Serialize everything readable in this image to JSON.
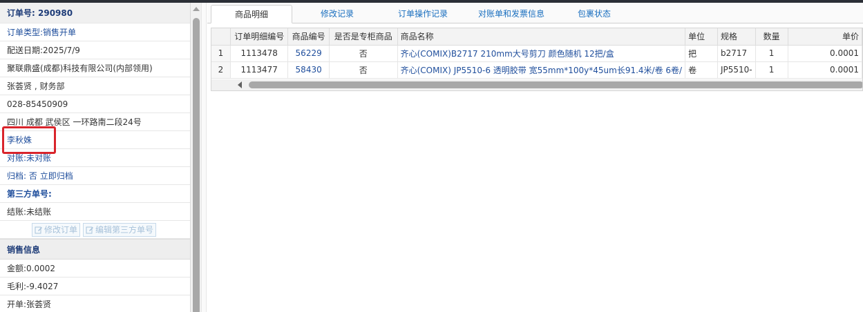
{
  "order": {
    "order_no_label": "订单号:",
    "order_no": "290980",
    "type_label": "订单类型:",
    "type_value": "销售开单",
    "delivery_date": "配送日期:2025/7/9",
    "company": "聚联鼎盛(成都)科技有限公司(内部领用)",
    "contact": "张荟贤 , 财务部",
    "phone": "028-85450909",
    "address": "四川 成都 武侯区 一环路南二段24号",
    "person": "李秋姝",
    "reconcile_label": "对账:",
    "reconcile_value": "未对账",
    "archive_label": "归档:",
    "archive_value": "否 立即归档",
    "third_party_label": "第三方单号:",
    "settle": "结账:未结账",
    "edit_order_button": "修改订单",
    "edit_third_party_button": "编辑第三方单号"
  },
  "sales": {
    "section_title": "销售信息",
    "amount": "金额:0.0002",
    "profit": "毛利:-9.4027",
    "issuer": "开单:张荟贤"
  },
  "tabs": [
    {
      "label": "商品明细",
      "active": true
    },
    {
      "label": "修改记录",
      "active": false
    },
    {
      "label": "订单操作记录",
      "active": false
    },
    {
      "label": "对账单和发票信息",
      "active": false
    },
    {
      "label": "包裹状态",
      "active": false
    }
  ],
  "table": {
    "headers": [
      "",
      "订单明细编号",
      "商品编号",
      "是否是专柜商品",
      "商品名称",
      "单位",
      "规格",
      "数量",
      "单价"
    ],
    "rows": [
      [
        "1",
        "1113478",
        "56229",
        "否",
        "齐心(COMIX)B2717 210mm大号剪刀 颜色随机 12把/盒",
        "把",
        "b2717",
        "1",
        "0.0001"
      ],
      [
        "2",
        "1113477",
        "58430",
        "否",
        "齐心(COMIX) JP5510-6 透明胶带 宽55mm*100y*45um长91.4米/卷 6卷/",
        "卷",
        "JP5510-",
        "1",
        "0.0001"
      ]
    ]
  },
  "colors": {
    "link_blue": "#1f4e9c",
    "tab_blue": "#1a6fbf",
    "highlight_red": "#d9242b"
  }
}
